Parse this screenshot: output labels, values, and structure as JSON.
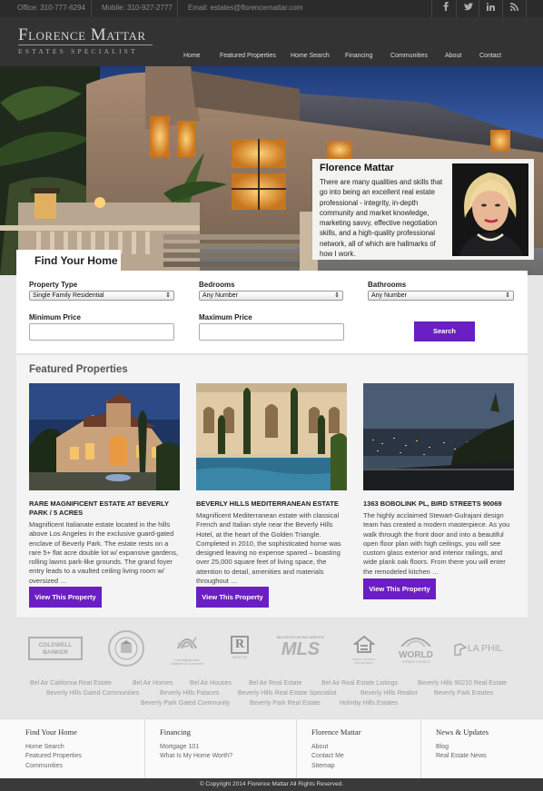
{
  "topbar": {
    "office": "Office: 310-777-6294",
    "mobile": "Mobile: 310-927-2777",
    "email": "Email: estates@florencemattar.com",
    "social": [
      "facebook-icon",
      "twitter-icon",
      "linkedin-icon",
      "rss-icon"
    ]
  },
  "header": {
    "logo_main": "Florence Mattar",
    "logo_sub": "ESTATES SPECIALIST",
    "nav": [
      "Home",
      "Featured Properties",
      "Home Search",
      "Financing",
      "Communities",
      "About",
      "Contact"
    ]
  },
  "hero": {
    "bio_name": "Florence Mattar",
    "bio_text": "There are many qualities and skills that go into being an excellent real estate professional - integrity, in-depth community and market knowledge, marketing savvy, effective negotiation skills, and a high-quality professional network, all of which are hallmarks of how I work."
  },
  "search": {
    "tab_title": "Find Your Home",
    "property_type_label": "Property Type",
    "property_type_value": "Single Family Residential",
    "bedrooms_label": "Bedrooms",
    "bedrooms_value": "Any Number",
    "bathrooms_label": "Bathrooms",
    "bathrooms_value": "Any Number",
    "min_price_label": "Minimum Price",
    "max_price_label": "Maximum Price",
    "search_button": "Search"
  },
  "featured": {
    "title": "Featured Properties",
    "button_label": "View This Property",
    "cards": [
      {
        "title": "RARE MAGNIFICENT ESTATE AT BEVERLY PARK / 5 ACRES",
        "description": "Magnificent Italianate estate located in the hills above Los Angeles in the exclusive guard-gated enclave of Beverly Park. The estate rests on a rare 5+ flat acre double lot w/ expansive gardens, rolling lawns park-like grounds. The grand foyer entry leads to a vaulted ceiling living room w/ oversized …"
      },
      {
        "title": "BEVERLY HILLS MEDITERRANEAN ESTATE",
        "description": "Magnificent Mediterranean estate with classical French and Italian style near the Beverly Hills Hotel, at the heart of the Golden Triangle. Completed in 2010, the sophisticated home was designed leaving no expense spared – boasting over 25,000 square feet of living space, the attention to detail, amenities and materials throughout …"
      },
      {
        "title": "1363 BOBOLINK PL, BIRD STREETS 90069",
        "description": "The highly acclaimed Stewart-Gulrajani design team has created a modern masterpiece. As you walk through the front door and into a beautiful open floor plan with high ceilings, you will see custom glass exterior and interior railings, and wide plank oak floors. From there you will enter the remodeled kitchen …"
      }
    ]
  },
  "logos": {
    "coldwell": "COLDWELL BANKER",
    "chamber": "Los Angeles Area Chamber of Commerce",
    "realtor": "REALTOR",
    "mls_top": "MULTIPLE LISTING SERVICE",
    "mls": "MLS",
    "equal_housing": "EQUAL HOUSING OPPORTUNITY",
    "world": "WORLD",
    "world_sub": "AFFAIRS COUNCIL",
    "laphil": "LA PHIL"
  },
  "seo_links": {
    "row1": [
      "Bel Air California Real Estate",
      "Bel Air Homes",
      "Bel Air Houses",
      "Bel Air Real Estate",
      "Bel Air Real Estate Listings",
      "Beverly Hills 90210 Real Estate"
    ],
    "row2": [
      "Beverly Hills Gated Communities",
      "Beverly Hills Palaces",
      "Beverly Hills Real Estate Specialist",
      "Beverly Hills Realtor",
      "Beverly Park Estates"
    ],
    "row3": [
      "Beverly Park Gated Community",
      "Beverly Park Real Estate",
      "Holmby Hills Estates"
    ]
  },
  "footer": {
    "columns": [
      {
        "title": "Find Your Home",
        "links": [
          "Home Search",
          "Featured Properties",
          "Communities"
        ]
      },
      {
        "title": "Financing",
        "links": [
          "Mortgage 101",
          "What Is My Home Worth?"
        ]
      },
      {
        "title": "Florence Mattar",
        "links": [
          "About",
          "Contact Me",
          "Sitemap"
        ]
      },
      {
        "title": "News & Updates",
        "links": [
          "Blog",
          "Real Estate News"
        ]
      }
    ],
    "copyright": "© Copyright 2014 Florence Mattar All Rights Reserved."
  }
}
